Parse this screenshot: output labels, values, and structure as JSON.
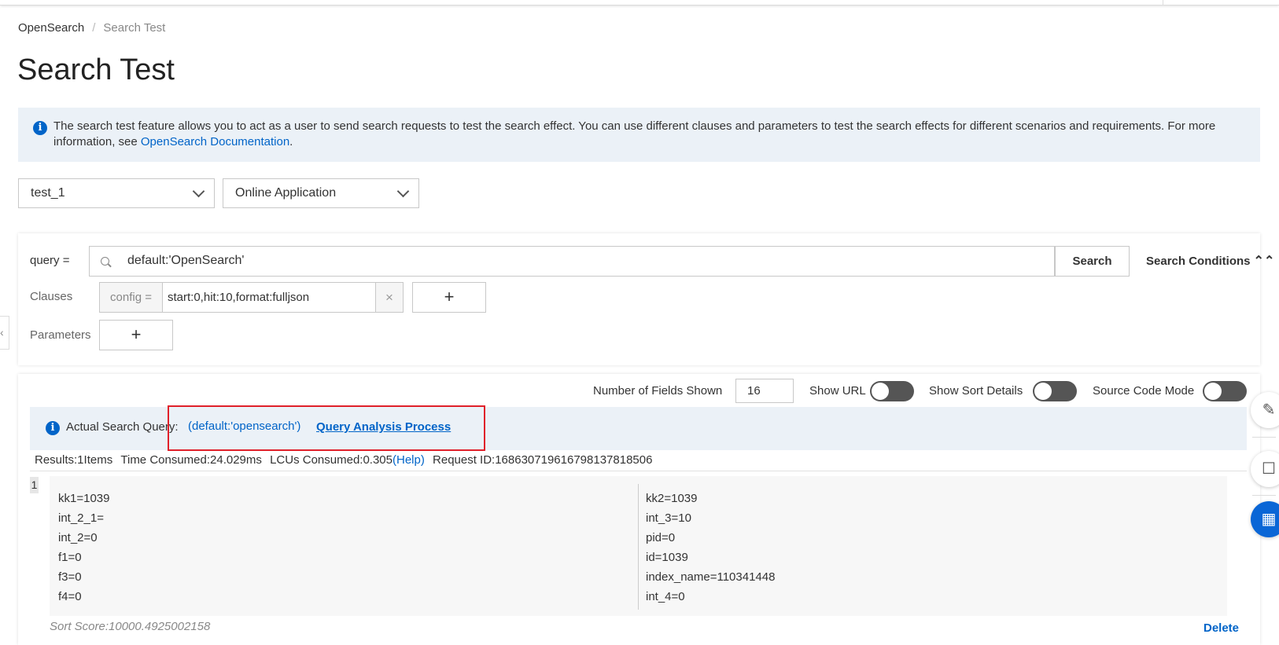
{
  "breadcrumb": {
    "root": "OpenSearch",
    "separator": "/",
    "current": "Search Test"
  },
  "page_title": "Search Test",
  "info_banner": {
    "text": "The search test feature allows you to act as a user to send search requests to test the search effect. You can use different clauses and parameters to test the search effects for different scenarios and requirements. For more information, see ",
    "link": "OpenSearch Documentation",
    "trailing": "."
  },
  "selects": {
    "app": "test_1",
    "env": "Online Application"
  },
  "query": {
    "label": "query =",
    "value": "default:'OpenSearch'",
    "search_button": "Search",
    "conditions_toggle": "Search Conditions",
    "conditions_chevron": "⌃⌃"
  },
  "clauses": {
    "label": "Clauses",
    "prefix": "config =",
    "value": "start:0,hit:10,format:fulljson",
    "clear": "×",
    "add": "+"
  },
  "parameters": {
    "label": "Parameters",
    "add": "+"
  },
  "toolbar": {
    "fields_label": "Number of Fields Shown",
    "fields_value": "16",
    "show_url": "Show URL",
    "show_sort": "Show Sort Details",
    "source_mode": "Source Code Mode"
  },
  "actual_query": {
    "label": "Actual Search Query:",
    "value": "(default:'opensearch')",
    "analysis_link": "Query Analysis Process"
  },
  "stats": {
    "results": "Results:1Items",
    "time": "Time Consumed:24.029ms",
    "lcus": "LCUs Consumed:0.305",
    "help": "(Help)",
    "request_id": "Request ID:1686307196167981378185​06"
  },
  "result": {
    "index": "1",
    "left_fields": [
      "kk1=1039",
      "int_2_1=",
      "int_2=0",
      "f1=0",
      "f3=0",
      "f4=0"
    ],
    "right_fields": [
      "kk2=1039",
      "int_3=10",
      "pid=0",
      "id=1039",
      "index_name=110341448",
      "int_4=0"
    ],
    "sort_score": "Sort Score:10000.4925002158",
    "delete": "Delete"
  },
  "icons": {
    "info": "info-icon",
    "search": "search-icon",
    "edit": "edit-icon",
    "chat": "chat-icon",
    "apps": "apps-icon"
  },
  "colors": {
    "link": "#0064c8",
    "highlight": "#e0202a",
    "banner": "#ebf1f7"
  }
}
